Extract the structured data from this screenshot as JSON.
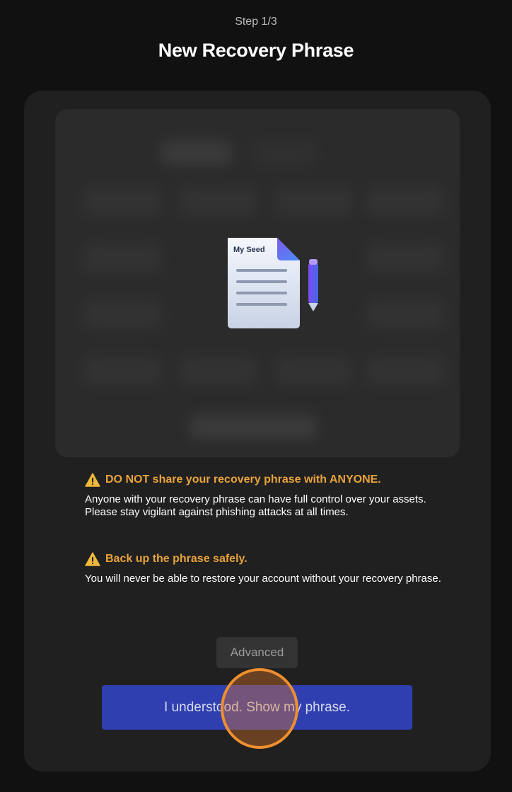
{
  "header": {
    "step": "Step 1/3",
    "title": "New Recovery Phrase"
  },
  "seed_panel": {
    "illustration_label": "My Seed",
    "icon": "seed-document-icon"
  },
  "warnings": [
    {
      "icon": "warning-triangle-icon",
      "title": "DO NOT share your recovery phrase with ANYONE.",
      "body": "Anyone with your recovery phrase can have full control over your assets. Please stay vigilant against phishing attacks at all times."
    },
    {
      "icon": "warning-triangle-icon",
      "title": "Back up the phrase safely.",
      "body": "You will never be able to restore your account without your recovery phrase."
    }
  ],
  "actions": {
    "advanced_label": "Advanced",
    "confirm_label": "I understood. Show my phrase."
  },
  "colors": {
    "background": "#111111",
    "card": "#202020",
    "warning": "#e8a33c",
    "primary": "#2f3fb0",
    "click_marker": "#ef8f2e"
  }
}
